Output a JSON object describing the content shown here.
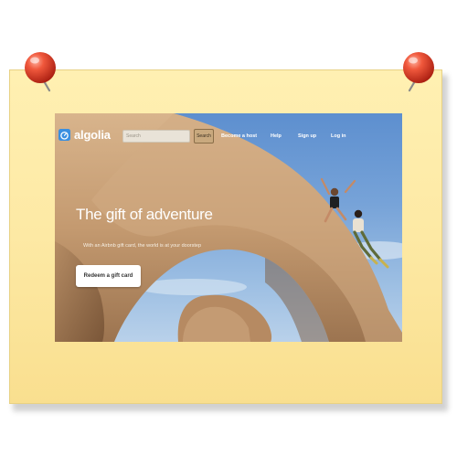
{
  "nav": {
    "logo_text": "algolia",
    "logo_icon": "stopwatch-icon",
    "search_placeholder": "Search",
    "search_button_label": "Search",
    "links": [
      "Become a host",
      "Help",
      "Sign up",
      "Log in"
    ]
  },
  "hero": {
    "title": "The gift of adventure",
    "subtitle": "With an Airbnb gift card, the world is at your doorstep",
    "cta_label": "Redeem a gift card"
  },
  "colors": {
    "note": "#fde9a4",
    "pin": "#e5402a",
    "logo_accent": "#3a8fe0",
    "sky": "#6f9fd6",
    "rock": "#c9a27a"
  },
  "icons": [
    "pushpin-icon",
    "stopwatch-icon"
  ]
}
